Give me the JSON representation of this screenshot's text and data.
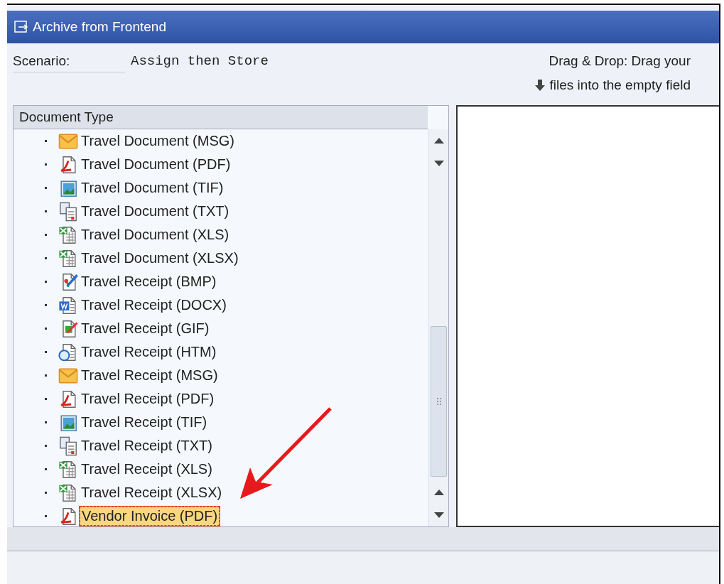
{
  "window": {
    "title": "Archive from Frontend"
  },
  "scenario": {
    "label": "Scenario:",
    "value": "Assign then Store"
  },
  "drag_hint": {
    "line_1": "Drag & Drop: Drag your",
    "line_2": "files into the empty field"
  },
  "tree": {
    "header": "Document Type",
    "items": [
      {
        "label": "Travel Document (MSG)",
        "kind": "msg",
        "selected": false
      },
      {
        "label": "Travel Document (PDF)",
        "kind": "pdf",
        "selected": false
      },
      {
        "label": "Travel Document (TIF)",
        "kind": "tif",
        "selected": false
      },
      {
        "label": "Travel Document (TXT)",
        "kind": "txt",
        "selected": false
      },
      {
        "label": "Travel Document (XLS)",
        "kind": "xls",
        "selected": false
      },
      {
        "label": "Travel Document (XLSX)",
        "kind": "xls",
        "selected": false
      },
      {
        "label": "Travel Receipt (BMP)",
        "kind": "bmp",
        "selected": false
      },
      {
        "label": "Travel Receipt (DOCX)",
        "kind": "docx",
        "selected": false
      },
      {
        "label": "Travel Receipt (GIF)",
        "kind": "gif",
        "selected": false
      },
      {
        "label": "Travel Receipt (HTM)",
        "kind": "htm",
        "selected": false
      },
      {
        "label": "Travel Receipt (MSG)",
        "kind": "msg",
        "selected": false
      },
      {
        "label": "Travel Receipt (PDF)",
        "kind": "pdf",
        "selected": false
      },
      {
        "label": "Travel Receipt (TIF)",
        "kind": "tif",
        "selected": false
      },
      {
        "label": "Travel Receipt (TXT)",
        "kind": "txt",
        "selected": false
      },
      {
        "label": "Travel Receipt (XLS)",
        "kind": "xls",
        "selected": false
      },
      {
        "label": "Travel Receipt (XLSX)",
        "kind": "xls",
        "selected": false
      },
      {
        "label": "Vendor Invoice (PDF)",
        "kind": "pdf",
        "selected": true
      }
    ]
  }
}
